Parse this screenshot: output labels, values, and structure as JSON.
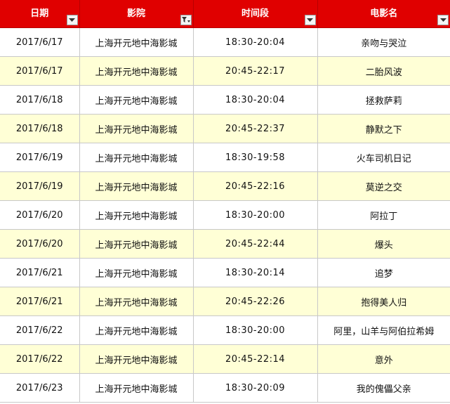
{
  "table": {
    "headers": [
      {
        "key": "date",
        "label": "日期",
        "filter": "dropdown"
      },
      {
        "key": "cinema",
        "label": "影院",
        "filter": "filtered"
      },
      {
        "key": "time",
        "label": "时间段",
        "filter": "dropdown"
      },
      {
        "key": "movie",
        "label": "电影名",
        "filter": "dropdown"
      }
    ],
    "rows": [
      {
        "date": "2017/6/17",
        "cinema": "上海开元地中海影城",
        "time": "18:30-20:04",
        "movie": "亲吻与哭泣"
      },
      {
        "date": "2017/6/17",
        "cinema": "上海开元地中海影城",
        "time": "20:45-22:17",
        "movie": "二胎风波"
      },
      {
        "date": "2017/6/18",
        "cinema": "上海开元地中海影城",
        "time": "18:30-20:04",
        "movie": "拯救萨莉"
      },
      {
        "date": "2017/6/18",
        "cinema": "上海开元地中海影城",
        "time": "20:45-22:37",
        "movie": "静默之下"
      },
      {
        "date": "2017/6/19",
        "cinema": "上海开元地中海影城",
        "time": "18:30-19:58",
        "movie": "火车司机日记"
      },
      {
        "date": "2017/6/19",
        "cinema": "上海开元地中海影城",
        "time": "20:45-22:16",
        "movie": "莫逆之交"
      },
      {
        "date": "2017/6/20",
        "cinema": "上海开元地中海影城",
        "time": "18:30-20:00",
        "movie": "阿拉丁"
      },
      {
        "date": "2017/6/20",
        "cinema": "上海开元地中海影城",
        "time": "20:45-22:44",
        "movie": "爆头"
      },
      {
        "date": "2017/6/21",
        "cinema": "上海开元地中海影城",
        "time": "18:30-20:14",
        "movie": "追梦"
      },
      {
        "date": "2017/6/21",
        "cinema": "上海开元地中海影城",
        "time": "20:45-22:26",
        "movie": "抱得美人归"
      },
      {
        "date": "2017/6/22",
        "cinema": "上海开元地中海影城",
        "time": "18:30-20:00",
        "movie": "阿里，山羊与阿伯拉希姆"
      },
      {
        "date": "2017/6/22",
        "cinema": "上海开元地中海影城",
        "time": "20:45-22:14",
        "movie": "意外"
      },
      {
        "date": "2017/6/23",
        "cinema": "上海开元地中海影城",
        "time": "18:30-20:09",
        "movie": "我的傀儡父亲"
      }
    ]
  },
  "colors": {
    "header_bg": "#e00000",
    "header_text": "#ffffff",
    "band_row": "#ffffd6",
    "plain_row": "#ffffff"
  },
  "icons": {
    "dropdown": "filter-dropdown-icon",
    "filtered": "filter-active-icon"
  }
}
